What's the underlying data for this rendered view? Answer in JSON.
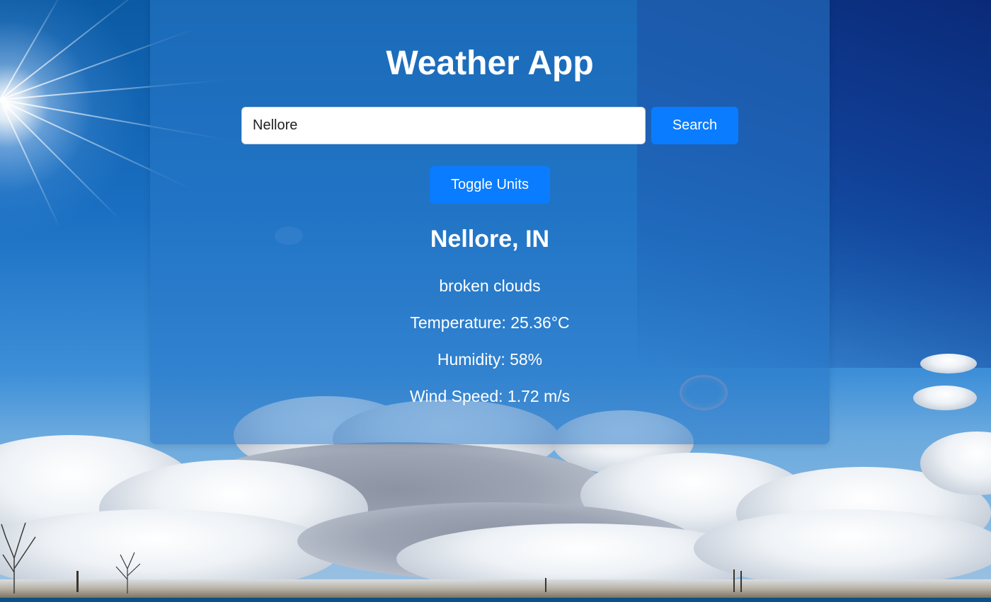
{
  "app": {
    "title": "Weather App"
  },
  "search": {
    "value": "Nellore",
    "button_label": "Search"
  },
  "controls": {
    "toggle_units_label": "Toggle Units"
  },
  "weather": {
    "location": "Nellore, IN",
    "description": "broken clouds",
    "temperature_text": "Temperature: 25.36°C",
    "humidity_text": "Humidity: 58%",
    "wind_speed_text": "Wind Speed: 1.72 m/s"
  },
  "colors": {
    "accent": "#0a7cff",
    "text": "#ffffff"
  }
}
